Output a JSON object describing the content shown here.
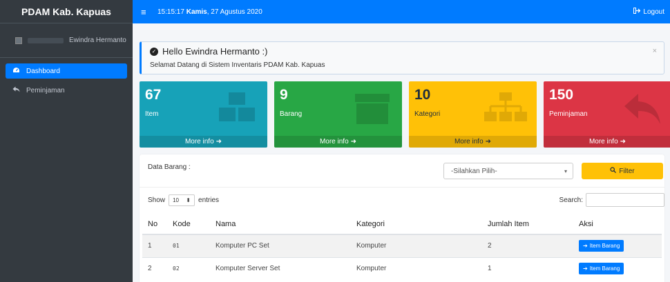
{
  "sidebar": {
    "brand": "PDAM Kab. Kapuas",
    "user_name": "Ewindra Hermanto",
    "items": [
      {
        "label": "Dashboard",
        "icon": "tachometer-icon",
        "active": true
      },
      {
        "label": "Peminjaman",
        "icon": "share-icon",
        "active": false
      }
    ]
  },
  "topbar": {
    "time": "15:15:17",
    "day": "Kamis",
    "date": ", 27 Agustus 2020",
    "logout_label": "Logout"
  },
  "alert": {
    "title": "Hello Ewindra Hermanto :)",
    "text": "Selamat Datang di Sistem Inventaris PDAM Kab. Kapuas",
    "close": "×"
  },
  "stats": [
    {
      "value": "67",
      "label": "Item",
      "footer": "More info",
      "color": "#17a2b8"
    },
    {
      "value": "9",
      "label": "Barang",
      "footer": "More info",
      "color": "#28a745"
    },
    {
      "value": "10",
      "label": "Kategori",
      "footer": "More info",
      "color": "#ffc107"
    },
    {
      "value": "150",
      "label": "Peminjaman",
      "footer": "More info",
      "color": "#dc3545"
    }
  ],
  "card": {
    "title": "Data Barang :",
    "select_value": "-Silahkan Pilih-",
    "filter_label": "Filter",
    "show_label": "Show",
    "entries_value": "10",
    "entries_label": "entries",
    "search_label": "Search:"
  },
  "table": {
    "headers": [
      "No",
      "Kode",
      "Nama",
      "Kategori",
      "Jumlah Item",
      "Aksi"
    ],
    "rows": [
      {
        "no": "1",
        "kode": "01",
        "nama": "Komputer PC Set",
        "kategori": "Komputer",
        "jumlah": "2",
        "aksi": "Item Barang"
      },
      {
        "no": "2",
        "kode": "02",
        "nama": "Komputer Server Set",
        "kategori": "Komputer",
        "jumlah": "1",
        "aksi": "Item Barang"
      }
    ]
  }
}
